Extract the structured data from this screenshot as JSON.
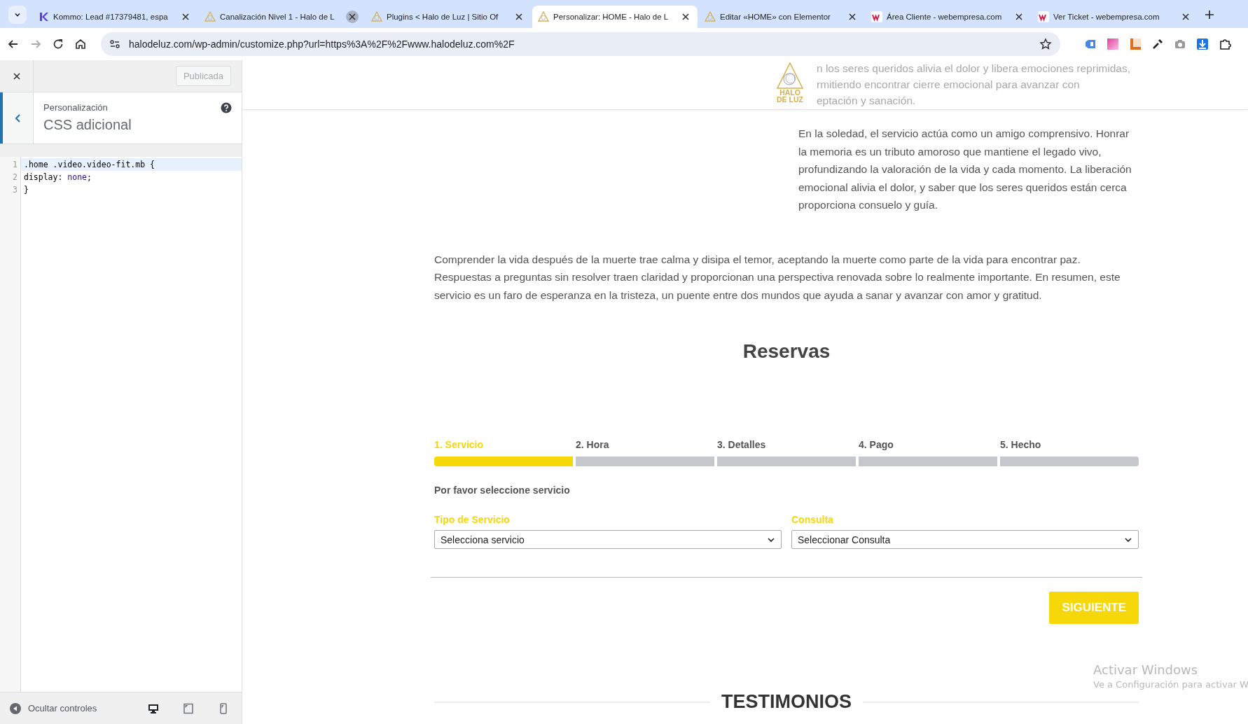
{
  "browser": {
    "tabs": [
      {
        "label": "Kommo: Lead #17379481, espa",
        "kind": "kommo",
        "selected": false,
        "close_hovered": false
      },
      {
        "label": "Canalización Nivel 1 - Halo de L",
        "kind": "halo",
        "selected": false,
        "close_hovered": true
      },
      {
        "label": "Plugins < Halo de Luz | Sitio Of",
        "kind": "halo",
        "selected": false,
        "close_hovered": false
      },
      {
        "label": "Personalizar: HOME - Halo de L",
        "kind": "halo",
        "selected": true,
        "close_hovered": false
      },
      {
        "label": "Editar «HOME» con Elementor",
        "kind": "halo",
        "selected": false,
        "close_hovered": false
      },
      {
        "label": "Área Cliente - webempresa.com",
        "kind": "webempresa",
        "selected": false,
        "close_hovered": false
      },
      {
        "label": "Ver Ticket - webempresa.com",
        "kind": "webempresa",
        "selected": false,
        "close_hovered": false
      }
    ],
    "url": "halodeluz.com/wp-admin/customize.php?url=https%3A%2F%2Fwww.halodeluz.com%2F"
  },
  "customizer": {
    "publish_button": "Publicada",
    "breadcrumb": "Personalización",
    "section_title": "CSS adicional",
    "code_lines": [
      {
        "number": "1",
        "highlighted": true,
        "segments": [
          {
            "text": ".home .video.video-fit.mb {",
            "kind": "plain"
          }
        ]
      },
      {
        "number": "2",
        "highlighted": false,
        "segments": [
          {
            "text": "display: ",
            "kind": "plain"
          },
          {
            "text": "none",
            "kind": "value"
          },
          {
            "text": ";",
            "kind": "plain"
          }
        ]
      },
      {
        "number": "3",
        "highlighted": false,
        "segments": [
          {
            "text": "}",
            "kind": "plain"
          }
        ]
      }
    ],
    "hide_controls": "Ocultar controles",
    "devices": [
      {
        "kind": "desktop",
        "selected": true
      },
      {
        "kind": "tablet",
        "selected": false
      },
      {
        "kind": "mobile",
        "selected": false
      }
    ]
  },
  "preview": {
    "header_faded_lines": [
      "n los seres queridos alivia el dolor y libera emociones reprimidas,",
      "rmitiendo encontrar cierre emocional para avanzar con",
      "eptación y sanación."
    ],
    "logo_text": "HALO DE LUZ",
    "paragraph_right": "En la soledad, el servicio actúa como un amigo comprensivo. Honrar la memoria es un tributo amoroso que mantiene el legado vivo, profundizando la valoración de la vida y cada momento. La liberación emocional alivia el dolor, y saber que los seres queridos están cerca proporciona consuelo y guía.",
    "paragraph_full": "Comprender la vida después de la muerte trae calma y disipa el temor, aceptando la muerte como parte de la vida para encontrar paz. Respuestas a preguntas sin resolver traen claridad y proporcionan una perspectiva renovada sobre lo realmente importante. En resumen, este servicio es un faro de esperanza en la tristeza, un puente entre dos mundos que ayuda a sanar y avanzar con amor y gratitud.",
    "booking": {
      "title": "Reservas",
      "steps": [
        {
          "label": "1. Servicio",
          "selected": true
        },
        {
          "label": "2. Hora",
          "selected": false
        },
        {
          "label": "3. Detalles",
          "selected": false
        },
        {
          "label": "4. Pago",
          "selected": false
        },
        {
          "label": "5. Hecho",
          "selected": false
        }
      ],
      "prompt": "Por favor seleccione servicio",
      "fields": [
        {
          "label": "Tipo de Servicio",
          "value": "Selecciona servicio"
        },
        {
          "label": "Consulta",
          "value": "Seleccionar Consulta"
        }
      ],
      "next_button": "SIGUIENTE"
    },
    "testimonials_title": "TESTIMONIOS"
  },
  "os_notice": {
    "title": "Activar Windows",
    "text": "Ve a Configuración para activar W"
  }
}
